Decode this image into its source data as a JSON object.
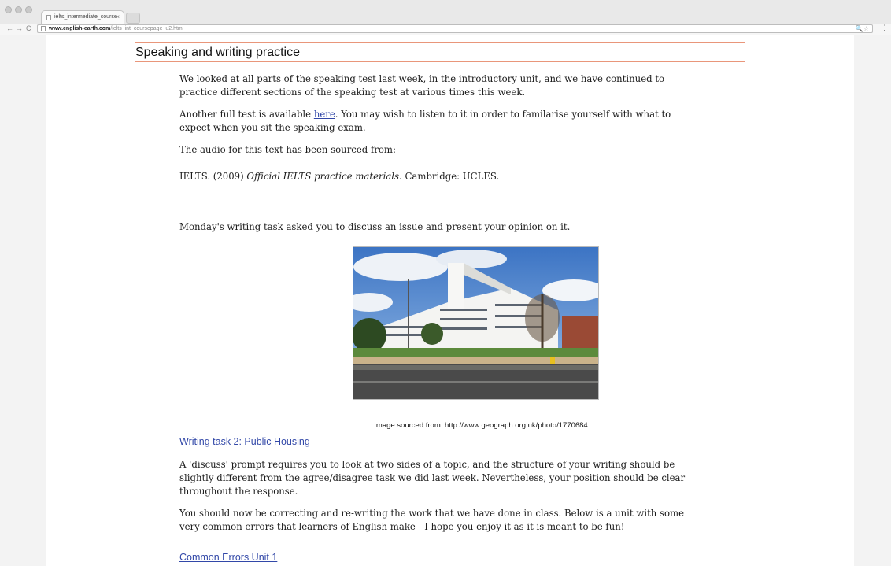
{
  "browser": {
    "tab_title": "ielts_intermediate_course",
    "tab_close": "×",
    "url_host": "www.english-earth.com",
    "url_path": "/ielts_int_coursepage_u2.html",
    "url_tools": "🔍☆"
  },
  "section": {
    "title": "Speaking and writing practice"
  },
  "content": {
    "p1": "We looked at all parts of the speaking test last week, in the introductory unit, and we have continued to practice different sections of the speaking test at various times this week.",
    "p2_before": "Another full test is available ",
    "p2_link": "here",
    "p2_after": ". You may wish to listen to it in order to familarise yourself with what to expect when you sit the speaking exam.",
    "p3": "The audio for this text has been sourced from:",
    "p4_before": "IELTS. (2009) ",
    "p4_italic": "Official IELTS practice materials",
    "p4_after": ". Cambridge: UCLES.",
    "p5": "Monday's writing task asked you to discuss an issue and present your opinion on it.",
    "caption": "Image sourced from: http://www.geograph.org.uk/photo/1770684",
    "link_writing_task": "Writing task 2: Public Housing",
    "p6": "A 'discuss' prompt requires you to look at two sides of a topic, and the structure of your writing should be slightly different from the agree/disagree task we did last week. Nevertheless, your position should be clear throughout the response.",
    "p7": "You should now be correcting and re-writing the work that we have done in class. Below is a unit with some very common errors that learners of English make - I hope you enjoy it as it is meant to be fun!",
    "link_common_errors": "Common Errors Unit 1"
  }
}
